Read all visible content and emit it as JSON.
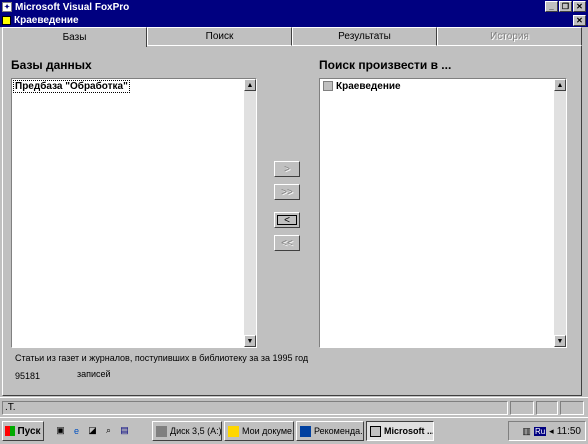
{
  "app": {
    "title": "Microsoft Visual FoxPro"
  },
  "form": {
    "title": "Краеведение"
  },
  "tabs": [
    {
      "label": "Базы",
      "state": "active"
    },
    {
      "label": "Поиск",
      "state": "normal"
    },
    {
      "label": "Результаты",
      "state": "normal"
    },
    {
      "label": "История",
      "state": "disabled"
    }
  ],
  "left_panel": {
    "label": "Базы данных",
    "items": [
      "Предбаза \"Обработка\""
    ]
  },
  "right_panel": {
    "label": "Поиск произвести в ...",
    "items": [
      "Краеведение"
    ]
  },
  "move_buttons": {
    "add": ">",
    "add_all": ">>",
    "remove": "<",
    "remove_all": "<<"
  },
  "info": {
    "description": "Статьи из газет и журналов, поступивших в библиотеку за за 1995 год",
    "count": "95181",
    "count_label": "записей"
  },
  "statusbar": {
    "text": ".T."
  },
  "taskbar": {
    "start_label": "Пуск",
    "tasks": [
      {
        "label": "Диск 3,5 (A:)"
      },
      {
        "label": "Мои докуме..."
      },
      {
        "label": "Рекоменда..."
      },
      {
        "label": "Microsoft ..."
      }
    ],
    "clock": "11:50",
    "lang": "Ru"
  }
}
